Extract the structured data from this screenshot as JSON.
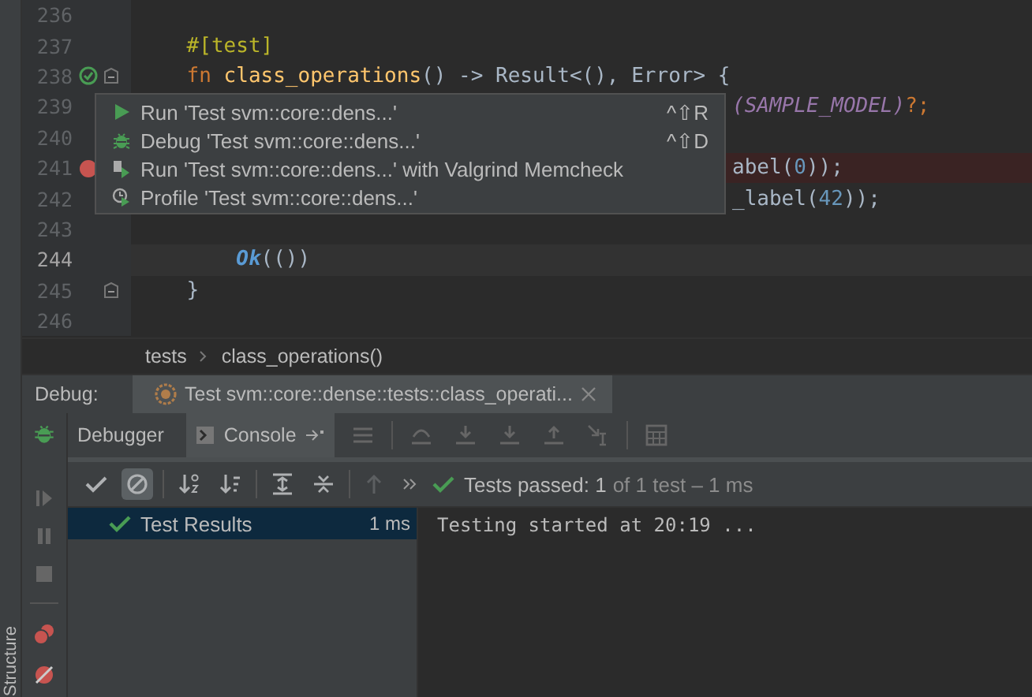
{
  "editor": {
    "lines": [
      {
        "number": "236",
        "test_marker": false,
        "breakpoint": false,
        "fold": false,
        "current": false
      },
      {
        "number": "237",
        "test_marker": false,
        "breakpoint": false,
        "fold": false,
        "current": false,
        "tokens": [
          {
            "t": "    #[test]",
            "kind": "attribute"
          }
        ]
      },
      {
        "number": "238",
        "test_marker": true,
        "breakpoint": false,
        "fold": true,
        "current": false,
        "tokens": [
          {
            "t": "    fn ",
            "kind": "keyword"
          },
          {
            "t": "class_operations",
            "kind": "function"
          },
          {
            "t": "() -> Result<(), Error> {",
            "kind": "plain"
          }
        ]
      },
      {
        "number": "239",
        "test_marker": false,
        "breakpoint": false,
        "current": false,
        "tail": [
          {
            "t": "(SAMPLE_MODEL)",
            "kind": "constant"
          },
          {
            "t": "?;",
            "kind": "keyword"
          }
        ]
      },
      {
        "number": "240",
        "test_marker": false,
        "breakpoint": false,
        "current": false
      },
      {
        "number": "241",
        "test_marker": false,
        "breakpoint": true,
        "current": false,
        "tail": [
          {
            "t": "abel(",
            "kind": "plain"
          },
          {
            "t": "0",
            "kind": "number"
          },
          {
            "t": "));",
            "kind": "plain"
          }
        ]
      },
      {
        "number": "242",
        "test_marker": false,
        "breakpoint": false,
        "current": false,
        "tail": [
          {
            "t": "_label(",
            "kind": "plain"
          },
          {
            "t": "42",
            "kind": "number"
          },
          {
            "t": "));",
            "kind": "plain"
          }
        ]
      },
      {
        "number": "243",
        "test_marker": false,
        "breakpoint": false,
        "fold": false,
        "current": false
      },
      {
        "number": "244",
        "test_marker": false,
        "breakpoint": false,
        "fold": false,
        "current": true,
        "tokens": [
          {
            "t": "        Ok",
            "kind": "variant"
          },
          {
            "t": "(())",
            "kind": "plain"
          }
        ]
      },
      {
        "number": "245",
        "test_marker": false,
        "breakpoint": false,
        "fold": true,
        "current": false,
        "tokens": [
          {
            "t": "    }",
            "kind": "plain"
          }
        ]
      },
      {
        "number": "246",
        "test_marker": false,
        "breakpoint": false,
        "fold": false,
        "current": false
      }
    ]
  },
  "popup": {
    "items": [
      {
        "kind": "run",
        "label": "Run 'Test svm::core::dens...'",
        "shortcut": "^⇧R"
      },
      {
        "kind": "debug",
        "label": "Debug 'Test svm::core::dens...'",
        "shortcut": "^⇧D"
      },
      {
        "kind": "valgrind",
        "label": "Run 'Test svm::core::dens...' with Valgrind Memcheck"
      },
      {
        "kind": "profile",
        "label": "Profile 'Test svm::core::dens...'"
      }
    ]
  },
  "breadcrumb": [
    "tests",
    "class_operations()"
  ],
  "debug_bar": {
    "label": "Debug:",
    "session": "Test svm::core::dense::tests::class_operati..."
  },
  "tabs": [
    {
      "label": "Debugger",
      "selected": false
    },
    {
      "label": "Console",
      "selected": true
    }
  ],
  "filters": [
    {
      "kind": "passed",
      "on": false
    },
    {
      "kind": "ignored",
      "on": true
    }
  ],
  "status": {
    "main": "Tests passed: 1",
    "detail": "of 1 test – 1 ms"
  },
  "tree": [
    {
      "label": "Test Results",
      "time": "1 ms",
      "selected": true
    }
  ],
  "console": [
    "Testing started at 20:19 ..."
  ],
  "side_strip": {
    "label": "Structure"
  }
}
